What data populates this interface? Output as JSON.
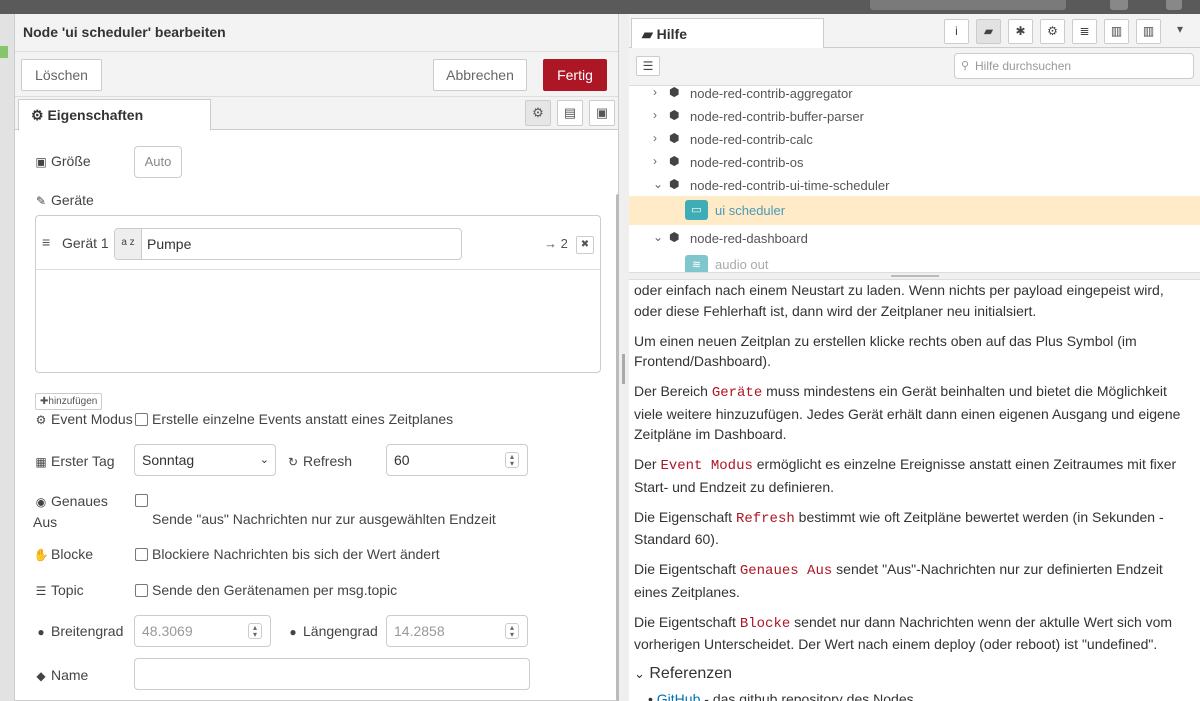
{
  "editor": {
    "title": "Node 'ui scheduler' bearbeiten",
    "buttons": {
      "delete": "Löschen",
      "cancel": "Abbrechen",
      "done": "Fertig"
    },
    "tab": "Eigenschaften",
    "fields": {
      "size_label": "Größe",
      "size_value": "Auto",
      "devices_label": "Geräte",
      "device_row_label": "Gerät 1",
      "device_type_glyph": "a z",
      "device_value": "Pumpe",
      "device_output": "→ 2",
      "add_label": "hinzufügen",
      "event_mode_label": "Event Modus",
      "event_mode_text": "Erstelle einzelne Events anstatt eines Zeitplanes",
      "first_day_label": "Erster Tag",
      "first_day_value": "Sonntag",
      "refresh_label": "Refresh",
      "refresh_value": "60",
      "exact_off_label_1": "Genaues",
      "exact_off_label_2": "Aus",
      "exact_off_text": "Sende \"aus\" Nachrichten nur zur ausgewählten Endzeit",
      "block_label": "Blocke",
      "block_text": "Blockiere Nachrichten bis sich der Wert ändert",
      "topic_label": "Topic",
      "topic_text": "Sende den Gerätenamen per msg.topic",
      "lat_label": "Breitengrad",
      "lat_value": "48.3069",
      "lon_label": "Längengrad",
      "lon_value": "14.2858",
      "name_label": "Name",
      "name_value": ""
    }
  },
  "sidebar": {
    "tab": "Hilfe",
    "search_placeholder": "Hilfe durchsuchen",
    "tree": [
      {
        "label": "node-red-contrib-aggregator",
        "expanded": false
      },
      {
        "label": "node-red-contrib-buffer-parser",
        "expanded": false
      },
      {
        "label": "node-red-contrib-calc",
        "expanded": false
      },
      {
        "label": "node-red-contrib-os",
        "expanded": false
      },
      {
        "label": "node-red-contrib-ui-time-scheduler",
        "expanded": true
      },
      {
        "label": "ui scheduler",
        "node": true,
        "selected": true
      },
      {
        "label": "node-red-dashboard",
        "expanded": true
      },
      {
        "label": "audio out",
        "node": true
      }
    ],
    "help": {
      "p1": "oder einfach nach einem Neustart zu laden. Wenn nichts per payload eingepeist wird, oder diese Fehlerhaft ist, dann wird der Zeitplaner neu initialsiert.",
      "p2": "Um einen neuen Zeitplan zu erstellen klicke rechts oben auf das Plus Symbol (im Frontend/Dashboard).",
      "p3a": "Der Bereich ",
      "p3code": "Geräte",
      "p3b": " muss mindestens ein Gerät beinhalten und bietet die Möglichkeit viele weitere hinzuzufügen. Jedes Gerät erhält dann einen eigenen Ausgang und eigene Zeitpläne im Dashboard.",
      "p4a": "Der ",
      "p4code": "Event Modus",
      "p4b": " ermöglicht es einzelne Ereignisse anstatt einen Zeitraumes mit fixer Start- und Endzeit zu definieren.",
      "p5a": "Die Eigenschaft ",
      "p5code": "Refresh",
      "p5b": " bestimmt wie oft Zeitpläne bewertet werden (in Sekunden - Standard 60).",
      "p6a": "Die Eigentschaft ",
      "p6code": "Genaues Aus",
      "p6b": " sendet \"Aus\"-Nachrichten nur zur definierten Endzeit eines Zeitplanes.",
      "p7a": "Die Eigentschaft ",
      "p7code": "Blocke",
      "p7b": " sendet nur dann Nachrichten wenn der aktulle Wert sich vom vorherigen Unterscheidet. Der Wert nach einem deploy (oder reboot) ist \"undefined\".",
      "refs_heading": "Referenzen",
      "ref_link": "GitHub",
      "ref_text": " - das github repository des Nodes"
    }
  },
  "colors": {
    "primary": "#ad1625",
    "selected_row": "#ffebc7",
    "node_teal": "#3fadb5",
    "code_red": "#ad1625"
  }
}
